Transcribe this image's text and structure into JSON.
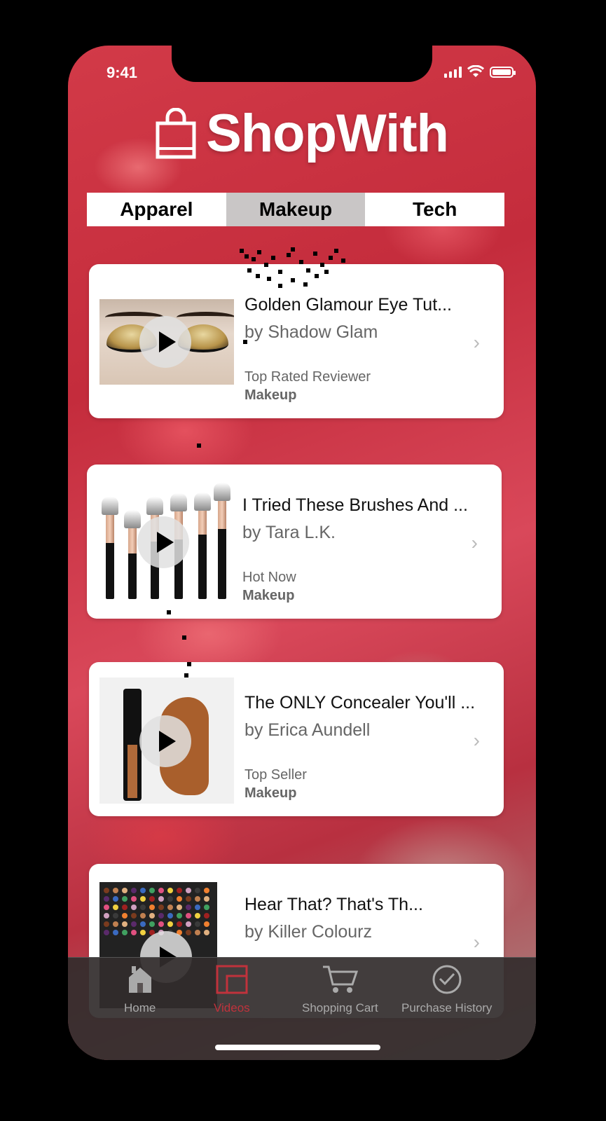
{
  "status": {
    "time": "9:41"
  },
  "brand": {
    "name": "ShopWith",
    "icon": "shopping-bag-icon"
  },
  "tabs": [
    {
      "label": "Apparel",
      "active": false
    },
    {
      "label": "Makeup",
      "active": true
    },
    {
      "label": "Tech",
      "active": false
    }
  ],
  "videos": [
    {
      "title": "Golden Glamour Eye Tut...",
      "author": "by Shadow Glam",
      "tag": "Top Rated Reviewer",
      "category": "Makeup"
    },
    {
      "title": "I Tried These Brushes And ...",
      "author": "by Tara L.K.",
      "tag": "Hot Now",
      "category": "Makeup"
    },
    {
      "title": "The ONLY Concealer You'll ...",
      "author": "by Erica Aundell",
      "tag": "Top Seller",
      "category": "Makeup"
    },
    {
      "title": "Hear That? That's Th...",
      "author": "by Killer Colourz",
      "tag": "",
      "category": ""
    }
  ],
  "nav": [
    {
      "label": "Home",
      "icon": "home-icon"
    },
    {
      "label": "Videos",
      "icon": "videos-icon",
      "active": true
    },
    {
      "label": "Shopping Cart",
      "icon": "cart-icon"
    },
    {
      "label": "Purchase History",
      "icon": "clock-icon"
    }
  ],
  "colors": {
    "accent": "#c0323c",
    "tab_active": "#c9c6c6",
    "navbar": "#322d2d"
  }
}
